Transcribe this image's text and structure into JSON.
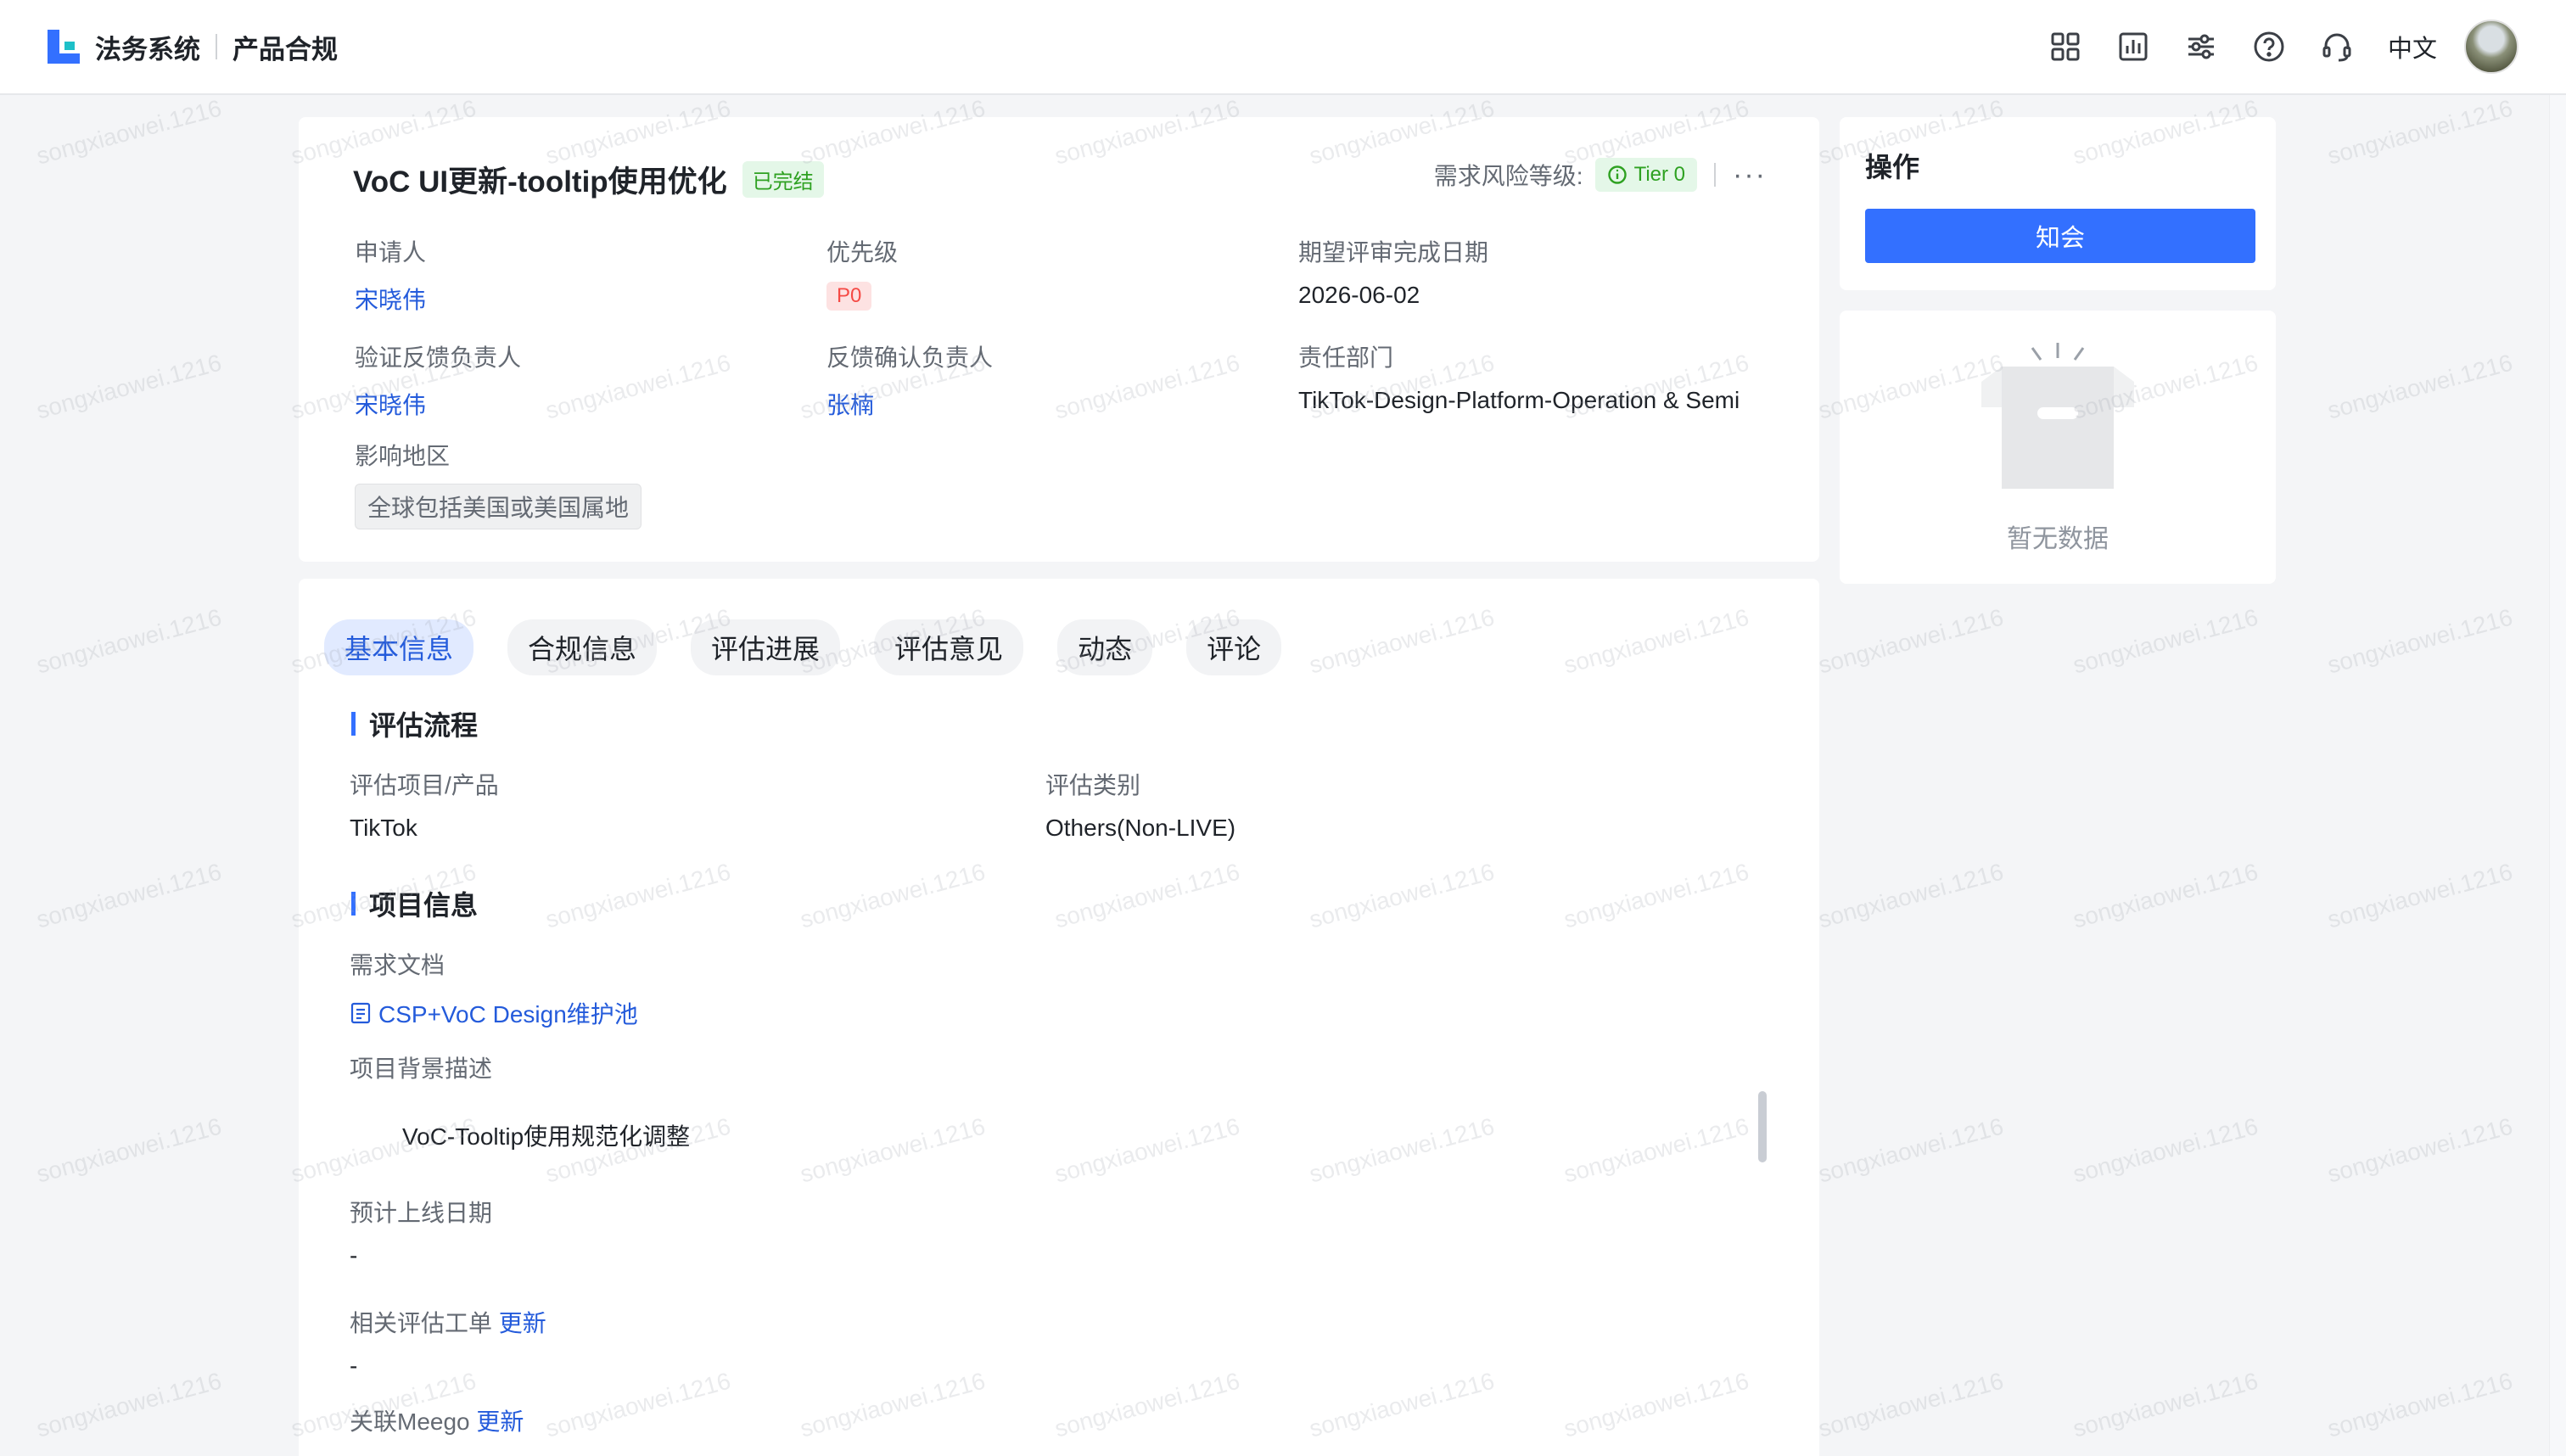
{
  "header": {
    "brand": "法务系统",
    "product": "产品合规",
    "language": "中文",
    "icons": [
      "grid-icon",
      "chart-icon",
      "sliders-icon",
      "help-icon",
      "headset-icon"
    ]
  },
  "request": {
    "title": "VoC UI更新-tooltip使用优化",
    "status": "已完结",
    "risk_label": "需求风险等级:",
    "risk_tier": "Tier 0",
    "fields": {
      "applicant_label": "申请人",
      "applicant": "宋晓伟",
      "priority_label": "优先级",
      "priority": "P0",
      "due_label": "期望评审完成日期",
      "due": "2026-06-02",
      "feedback_owner_label": "验证反馈负责人",
      "feedback_owner": "宋晓伟",
      "confirm_owner_label": "反馈确认负责人",
      "confirm_owner": "张楠",
      "dept_label": "责任部门",
      "dept": "TikTok-Design-Platform-Operation & Semi",
      "region_label": "影响地区",
      "region": "全球包括美国或美国属地"
    }
  },
  "tabs": [
    {
      "label": "基本信息",
      "active": true
    },
    {
      "label": "合规信息",
      "active": false
    },
    {
      "label": "评估进展",
      "active": false
    },
    {
      "label": "评估意见",
      "active": false
    },
    {
      "label": "动态",
      "active": false
    },
    {
      "label": "评论",
      "active": false
    }
  ],
  "basic": {
    "section_process": "评估流程",
    "project_label": "评估项目/产品",
    "project": "TikTok",
    "category_label": "评估类别",
    "category": "Others(Non-LIVE)",
    "section_project": "项目信息",
    "doc_label": "需求文档",
    "doc_link": "CSP+VoC Design维护池",
    "bg_label": "项目背景描述",
    "bg": "VoC-Tooltip使用规范化调整",
    "launch_label": "预计上线日期",
    "launch": "-",
    "related_label": "相关评估工单",
    "related_update": "更新",
    "related": "-",
    "meego_label": "关联Meego",
    "meego_update": "更新"
  },
  "ops": {
    "title": "操作",
    "button": "知会",
    "empty": "暂无数据"
  },
  "watermark": "songxiaowei.1216",
  "colors": {
    "accent": "#3370ff",
    "link": "#245bdb",
    "success": "#2ea121",
    "danger": "#f54a45"
  }
}
